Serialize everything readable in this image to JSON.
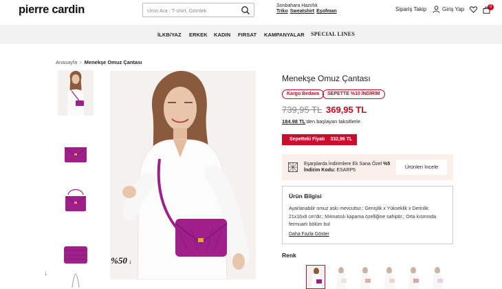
{
  "header": {
    "logo": "pierre cardin",
    "search_placeholder": "Ürün Ara : T-shirt, Gömlek",
    "promo_title": "Sonbahara Hazırlık",
    "promo_links": [
      "Triko",
      "Sweatshirt",
      "Eşofman"
    ],
    "order_tracking": "Sipariş Takip",
    "login": "Giriş Yap",
    "cart_count": "0"
  },
  "nav": {
    "items": [
      "İLKB/YAZ",
      "ERKEK",
      "KADIN",
      "FIRSAT",
      "KAMPANYALAR",
      "SPECIAL LINES"
    ]
  },
  "breadcrumb": {
    "home": "Anasayfa",
    "separator": ">",
    "current": "Menekşe Omuz Çantası"
  },
  "main_image": {
    "discount_badge": "%50"
  },
  "product": {
    "title": "Menekşe Omuz Çantası",
    "tags": [
      "Kargo Bedava",
      "SEPETTE %10 İNDİRİM"
    ],
    "old_price": "739,95 TL",
    "new_price": "369,95 TL",
    "installment_amount": "184.98 TL",
    "installment_text": "'den başlayan taksitlerle",
    "cart_price_label": "Sepetteki Fiyatı",
    "cart_price_value": "332,96 TL"
  },
  "scarf_promo": {
    "text": "Eşarplarda İndirimlere Ek Sana Özel ",
    "percent": "%5",
    "code_label": "İndirim Kodu:",
    "code": "ESARP5",
    "button": "Ürünleri İncele"
  },
  "product_info": {
    "heading": "Ürün Bilgisi",
    "description": "Ayarlanabilir omuz askı mevcuttur.; Genişlik x Yükseklik x Derinlik: 21x16x8 cm'dir.; Mıknatıslı kapama özelliğine sahiptir.; Orta kısmında fermuarlı bölüm bul",
    "show_more": "Daha Fazla Göster"
  },
  "color": {
    "label": "Renk"
  },
  "colors": {
    "brand_red": "#c8102e",
    "bag_purple": "#a0208a",
    "promo_bg": "#fbefec"
  }
}
